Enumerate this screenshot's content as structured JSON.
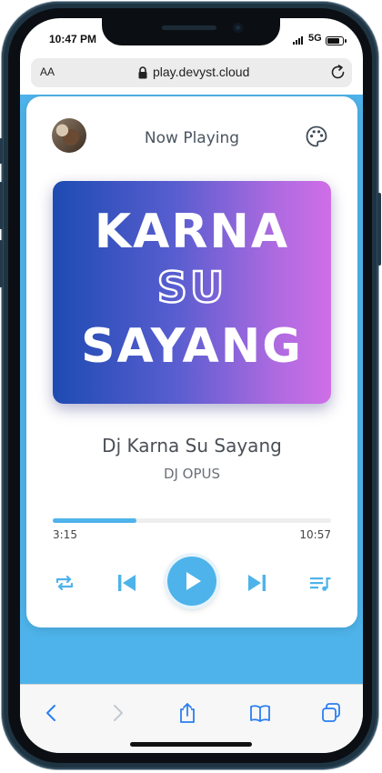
{
  "status_bar": {
    "time": "10:47 PM",
    "network": "5G"
  },
  "browser": {
    "text_size_label": "AA",
    "url": "play.devyst.cloud"
  },
  "player": {
    "header_title": "Now Playing",
    "cover_lines": [
      "KARNA",
      "SU",
      "SAYANG"
    ],
    "song_title": "Dj Karna Su Sayang",
    "artist": "DJ OPUS",
    "current_time": "3:15",
    "total_time": "10:57",
    "progress_fraction": 0.3,
    "accent_color": "#4eb3ea"
  },
  "icons": {
    "header": [
      "avatar",
      "palette-icon"
    ],
    "controls": [
      "repeat-icon",
      "previous-icon",
      "play-icon",
      "next-icon",
      "playlist-icon"
    ],
    "browser_toolbar": [
      "back-icon",
      "forward-icon",
      "share-icon",
      "bookmarks-icon",
      "tabs-icon"
    ]
  }
}
